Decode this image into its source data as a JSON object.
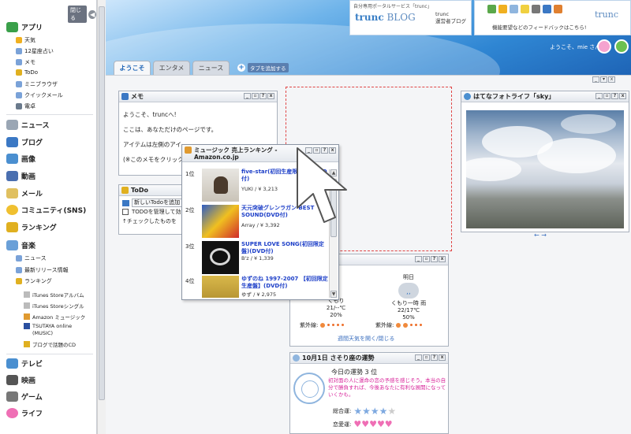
{
  "sidebar": {
    "close_label": "閉じる",
    "categories": [
      {
        "label": "アプリ",
        "icon": "app-icon",
        "color": "#3aa04a"
      },
      {
        "label": "ニュース",
        "icon": "news-icon",
        "color": "#6a7a8c"
      },
      {
        "label": "ブログ",
        "icon": "rss-icon",
        "color": "#3b78c4"
      },
      {
        "label": "画像",
        "icon": "image-icon",
        "color": "#4a8fd0"
      },
      {
        "label": "動画",
        "icon": "video-icon",
        "color": "#4a6fb0"
      },
      {
        "label": "メール",
        "icon": "mail-icon",
        "color": "#e0c060"
      },
      {
        "label": "コミュニティ(SNS)",
        "icon": "smile-icon",
        "color": "#f0c030"
      },
      {
        "label": "ランキング",
        "icon": "crown-icon",
        "color": "#e0b020"
      },
      {
        "label": "音楽",
        "icon": "music-icon",
        "color": "#6aa0d8"
      },
      {
        "label": "テレビ",
        "icon": "tv-icon",
        "color": "#4a8fd0"
      },
      {
        "label": "映画",
        "icon": "film-icon",
        "color": "#555"
      },
      {
        "label": "ゲーム",
        "icon": "game-icon",
        "color": "#777"
      },
      {
        "label": "ライフ",
        "icon": "heart-icon",
        "color": "#ef6fb5"
      }
    ],
    "app_items": [
      "天気",
      "12星座占い",
      "メモ",
      "ToDo",
      "ミニブラウザ",
      "クイックメール",
      "電卓"
    ],
    "music_items": [
      "ニュース",
      "最新リリース情報",
      "ランキング"
    ],
    "ranking_items": [
      "iTunes Storeアルバム",
      "iTunes Storeシングル",
      "Amazon ミュージック",
      "TSUTAYA online",
      "(MUSIC)",
      "ブログで話題のCD"
    ]
  },
  "header": {
    "promo_blog_caption": "自分専用ポータルサービス「trunc」",
    "promo_blog_logo": "trunc",
    "promo_blog_logo_suffix": "BLOG",
    "promo_blog_side1": "trunc",
    "promo_blog_side2": "運営者ブログ",
    "promo_feedback_text": "機能要望などのフィードバックはこちら!",
    "promo_feedback_brand": "trunc",
    "welcome": "ようこそ、mie さん",
    "tabs": [
      "ようこそ",
      "エンタメ",
      "ニュース"
    ],
    "add_tab_label": "タブを追加する"
  },
  "memo": {
    "title": "メモ",
    "lines": [
      "ようこそ、truncへ!",
      "ここは、あなただけのページです。",
      "アイテムは左側のアイ",
      "(※このメモをクリックす"
    ]
  },
  "todo": {
    "title": "ToDo",
    "add_label": "新しいTodoを追加",
    "items": [
      "TODOを管理して効",
      "↑チェックしたものを"
    ]
  },
  "music": {
    "title": "ミュージック 売上ランキング - Amazon.co.jp",
    "items": [
      {
        "rank": "1位",
        "title": "five-star(初回生産限定盤)(DVD付)",
        "artist": "YUKI / ¥ 3,213"
      },
      {
        "rank": "2位",
        "title": "天元突破グレンラガン BEST SOUND(DVD付)",
        "artist": "Array / ¥ 3,392"
      },
      {
        "rank": "3位",
        "title": "SUPER LOVE SONG(初回限定盤)(DVD付)",
        "artist": "B'z / ¥ 1,339"
      },
      {
        "rank": "4位",
        "title": "ゆずのね 1997-2007 【初回限定生産盤】(DVD付)",
        "artist": "ゆず / ¥ 2,975"
      }
    ]
  },
  "photo": {
    "title": "はてなフォトライフ「sky」",
    "nav": "← →"
  },
  "weather": {
    "tomorrow_label": "明日",
    "today_cond": "くもり",
    "today_temp": "21/--℃",
    "today_rain": "20%",
    "tomorrow_cond": "くもり一時 雨",
    "tomorrow_temp": "22/17℃",
    "tomorrow_rain": "50%",
    "uv_label": "紫外線:",
    "link": "週間天気を開く/閉じる"
  },
  "horoscope": {
    "title": "10月1日 さそり座の運勢",
    "rank_label": "今日の運勢 3 位",
    "text": "初対面の人に運命の恋の予感を感じそう。本当の自分で勝負すれば、今後あなたに有利な展開になっていくかも。",
    "overall_label": "総合運:",
    "love_label": "恋愛運:"
  }
}
